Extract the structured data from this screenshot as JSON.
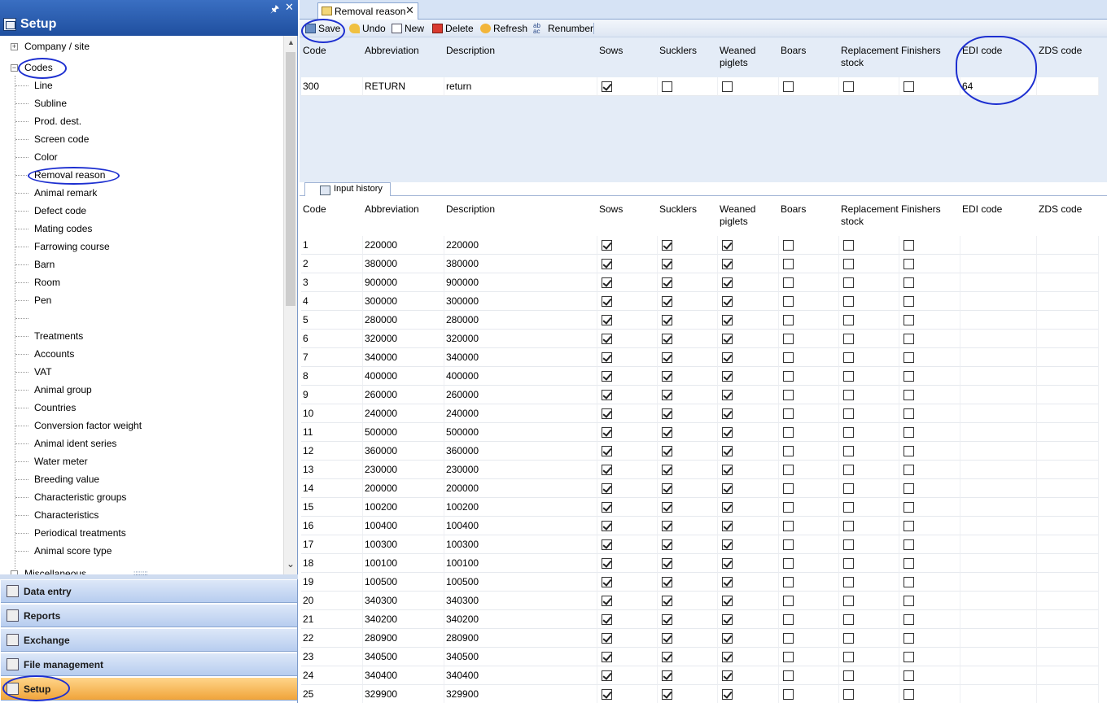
{
  "left_panel": {
    "title": "Setup",
    "tree": {
      "roots": [
        {
          "label": "Company / site",
          "expander": "+"
        },
        {
          "label": "Codes",
          "expander": "−"
        }
      ],
      "children": [
        "Line",
        "Subline",
        "Prod. dest.",
        "Screen code",
        "Color",
        "Removal reason",
        "Animal remark",
        "Defect code",
        "Mating codes",
        "Farrowing course",
        "Barn",
        "Room",
        "Pen",
        "",
        "Treatments",
        "Accounts",
        "VAT",
        "Animal group",
        "Countries",
        "Conversion factor weight",
        "Animal ident series",
        "Water meter",
        "Breeding value",
        "Characteristic groups",
        "Characteristics",
        "Periodical treatments",
        "Animal score type"
      ],
      "partial_bottom": "Miscellaneous"
    },
    "nav": [
      {
        "label": "Data entry",
        "icon": "data-entry-icon"
      },
      {
        "label": "Reports",
        "icon": "reports-icon"
      },
      {
        "label": "Exchange",
        "icon": "exchange-icon"
      },
      {
        "label": "File management",
        "icon": "file-management-icon"
      },
      {
        "label": "Setup",
        "icon": "setup-icon",
        "active": true
      }
    ]
  },
  "document_tab": {
    "label": "Removal reason"
  },
  "toolbar": {
    "save": "Save",
    "undo": "Undo",
    "new": "New",
    "delete": "Delete",
    "refresh": "Refresh",
    "renumber": "Renumber"
  },
  "columns": [
    "Code",
    "Abbreviation",
    "Description",
    "Sows",
    "Sucklers",
    "Weaned piglets",
    "Boars",
    "Replacement stock",
    "Finishers",
    "EDI code",
    "ZDS code"
  ],
  "edit_row": {
    "code": "300",
    "abbreviation": "RETURN",
    "description": "return",
    "sows": true,
    "sucklers": false,
    "weaned": false,
    "boars": false,
    "replacement": false,
    "finishers": false,
    "edi": "64",
    "zds": ""
  },
  "history_tab": {
    "label": "Input history"
  },
  "history_rows": [
    {
      "code": "1",
      "abbreviation": "220000",
      "description": "220000"
    },
    {
      "code": "2",
      "abbreviation": "380000",
      "description": "380000"
    },
    {
      "code": "3",
      "abbreviation": "900000",
      "description": "900000"
    },
    {
      "code": "4",
      "abbreviation": "300000",
      "description": "300000"
    },
    {
      "code": "5",
      "abbreviation": "280000",
      "description": "280000"
    },
    {
      "code": "6",
      "abbreviation": "320000",
      "description": "320000"
    },
    {
      "code": "7",
      "abbreviation": "340000",
      "description": "340000"
    },
    {
      "code": "8",
      "abbreviation": "400000",
      "description": "400000"
    },
    {
      "code": "9",
      "abbreviation": "260000",
      "description": "260000"
    },
    {
      "code": "10",
      "abbreviation": "240000",
      "description": "240000"
    },
    {
      "code": "11",
      "abbreviation": "500000",
      "description": "500000"
    },
    {
      "code": "12",
      "abbreviation": "360000",
      "description": "360000"
    },
    {
      "code": "13",
      "abbreviation": "230000",
      "description": "230000"
    },
    {
      "code": "14",
      "abbreviation": "200000",
      "description": "200000"
    },
    {
      "code": "15",
      "abbreviation": "100200",
      "description": "100200"
    },
    {
      "code": "16",
      "abbreviation": "100400",
      "description": "100400"
    },
    {
      "code": "17",
      "abbreviation": "100300",
      "description": "100300"
    },
    {
      "code": "18",
      "abbreviation": "100100",
      "description": "100100"
    },
    {
      "code": "19",
      "abbreviation": "100500",
      "description": "100500"
    },
    {
      "code": "20",
      "abbreviation": "340300",
      "description": "340300"
    },
    {
      "code": "21",
      "abbreviation": "340200",
      "description": "340200"
    },
    {
      "code": "22",
      "abbreviation": "280900",
      "description": "280900"
    },
    {
      "code": "23",
      "abbreviation": "340500",
      "description": "340500"
    },
    {
      "code": "24",
      "abbreviation": "340400",
      "description": "340400"
    },
    {
      "code": "25",
      "abbreviation": "329900",
      "description": "329900"
    }
  ],
  "history_flags": {
    "sows": true,
    "sucklers": true,
    "weaned": true,
    "boars": false,
    "replacement": false,
    "finishers": false
  }
}
